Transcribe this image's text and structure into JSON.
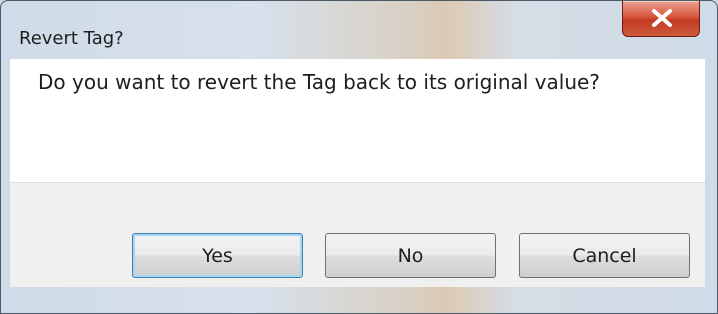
{
  "dialog": {
    "title": "Revert Tag?",
    "message": "Do you want to revert the Tag back to its original value?",
    "close_icon": "close-icon",
    "buttons": {
      "yes": "Yes",
      "no": "No",
      "cancel": "Cancel"
    },
    "default_button": "yes"
  },
  "colors": {
    "close_button": "#c8432a",
    "default_button_border": "#3c7fb1",
    "content_background": "#ffffff",
    "footer_background": "#f0f0f0"
  }
}
